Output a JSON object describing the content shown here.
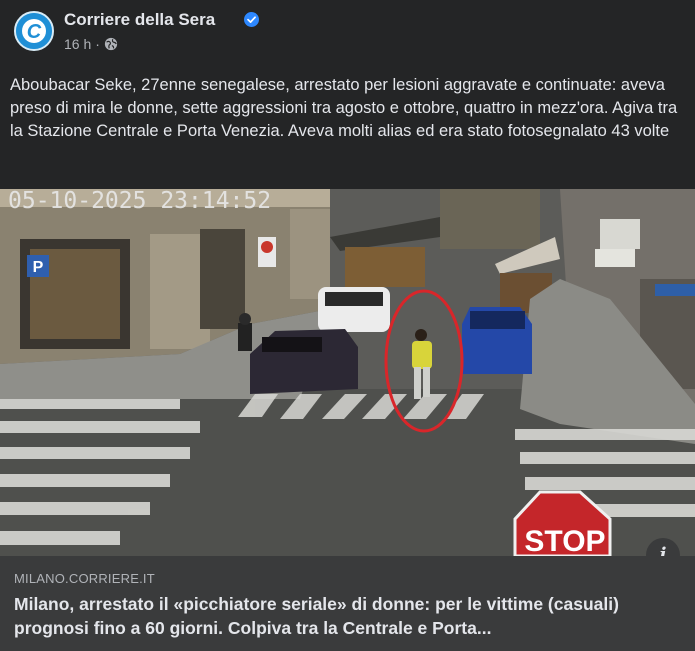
{
  "header": {
    "page_name": "Corriere della Sera",
    "timestamp": "16 h",
    "separator": "·",
    "avatar_letter": "C",
    "avatar_color": "#1f8fd6",
    "verified_color": "#2d88ff"
  },
  "post": {
    "caption": "Aboubacar Seke, 27enne senegalese, arrestato per lesioni aggravate e continuate: aveva preso di mira le donne, sette aggressioni tra agosto e ottobre, quattro in mezz'ora. Agiva tra la Stazione Centrale e Porta Venezia. Aveva molti alias ed era stato fotosegnalato 43 volte"
  },
  "photo": {
    "timestamp_overlay": "05-10-2025 23:14:52",
    "parking_sign": "P",
    "stop_sign": "STOP",
    "highlight_color": "#d9262a"
  },
  "link_card": {
    "domain": "MILANO.CORRIERE.IT",
    "headline": "Milano, arrestato il «picchiatore seriale» di donne: per le vittime (casuali) prognosi fino a 60 giorni. Colpiva tra la Centrale e Porta..."
  },
  "icons": {
    "info": "i"
  }
}
